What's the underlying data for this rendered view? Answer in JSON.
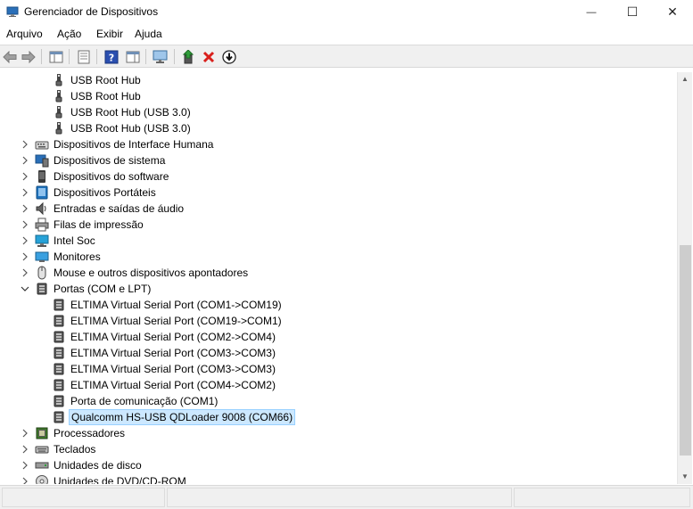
{
  "window": {
    "title": "Gerenciador de Dispositivos",
    "minimize_glyph": "—",
    "maximize_glyph": "☐",
    "close_glyph": "✕"
  },
  "menu": [
    "Arquivo",
    "Ação",
    "Exibir",
    "Ajuda"
  ],
  "toolbar": [
    "back-icon",
    "forward-icon",
    "show-hide-console-tree-icon",
    "properties-icon",
    "help-icon",
    "action-pane-icon",
    "monitor-scan-icon",
    "update-driver-icon",
    "uninstall-icon",
    "disable-device-icon"
  ],
  "tree": [
    {
      "label": "USB Root Hub",
      "icon": "usb-icon",
      "level": 2
    },
    {
      "label": "USB Root Hub",
      "icon": "usb-icon",
      "level": 2
    },
    {
      "label": "USB Root Hub (USB 3.0)",
      "icon": "usb-icon",
      "level": 2
    },
    {
      "label": "USB Root Hub (USB 3.0)",
      "icon": "usb-icon",
      "level": 2
    },
    {
      "label": "Dispositivos de Interface Humana",
      "icon": "hid-icon",
      "level": 1,
      "expander": "collapsed"
    },
    {
      "label": "Dispositivos de sistema",
      "icon": "system-devices-icon",
      "level": 1,
      "expander": "collapsed"
    },
    {
      "label": "Dispositivos do software",
      "icon": "software-device-icon",
      "level": 1,
      "expander": "collapsed"
    },
    {
      "label": "Dispositivos Portáteis",
      "icon": "portable-device-icon",
      "level": 1,
      "expander": "collapsed"
    },
    {
      "label": "Entradas e saídas de áudio",
      "icon": "audio-icon",
      "level": 1,
      "expander": "collapsed"
    },
    {
      "label": "Filas de impressão",
      "icon": "printer-icon",
      "level": 1,
      "expander": "collapsed"
    },
    {
      "label": "Intel Soc",
      "icon": "intel-soc-icon",
      "level": 1,
      "expander": "collapsed"
    },
    {
      "label": "Monitores",
      "icon": "monitor-icon",
      "level": 1,
      "expander": "collapsed"
    },
    {
      "label": "Mouse e outros dispositivos apontadores",
      "icon": "mouse-icon",
      "level": 1,
      "expander": "collapsed"
    },
    {
      "label": "Portas (COM e LPT)",
      "icon": "port-icon",
      "level": 1,
      "expander": "expanded"
    },
    {
      "label": "ELTIMA Virtual Serial Port (COM1->COM19)",
      "icon": "port-icon",
      "level": 2
    },
    {
      "label": "ELTIMA Virtual Serial Port (COM19->COM1)",
      "icon": "port-icon",
      "level": 2
    },
    {
      "label": "ELTIMA Virtual Serial Port (COM2->COM4)",
      "icon": "port-icon",
      "level": 2
    },
    {
      "label": "ELTIMA Virtual Serial Port (COM3->COM3)",
      "icon": "port-icon",
      "level": 2
    },
    {
      "label": "ELTIMA Virtual Serial Port (COM3->COM3)",
      "icon": "port-icon",
      "level": 2
    },
    {
      "label": "ELTIMA Virtual Serial Port (COM4->COM2)",
      "icon": "port-icon",
      "level": 2
    },
    {
      "label": "Porta de comunicação (COM1)",
      "icon": "port-icon",
      "level": 2
    },
    {
      "label": "Qualcomm HS-USB QDLoader 9008 (COM66)",
      "icon": "port-icon",
      "level": 2,
      "selected": true
    },
    {
      "label": "Processadores",
      "icon": "processor-icon",
      "level": 1,
      "expander": "collapsed"
    },
    {
      "label": "Teclados",
      "icon": "keyboard-icon",
      "level": 1,
      "expander": "collapsed"
    },
    {
      "label": "Unidades de disco",
      "icon": "disk-drive-icon",
      "level": 1,
      "expander": "collapsed"
    },
    {
      "label": "Unidades de DVD/CD-ROM",
      "icon": "dvd-icon",
      "level": 1,
      "expander": "collapsed"
    }
  ],
  "colors": {
    "selection_bg": "#cce8ff",
    "selection_border": "#99d1ff",
    "accent_blue": "#1e73be",
    "uninstall_red": "#d9201c",
    "update_green": "#2f9e3a"
  }
}
